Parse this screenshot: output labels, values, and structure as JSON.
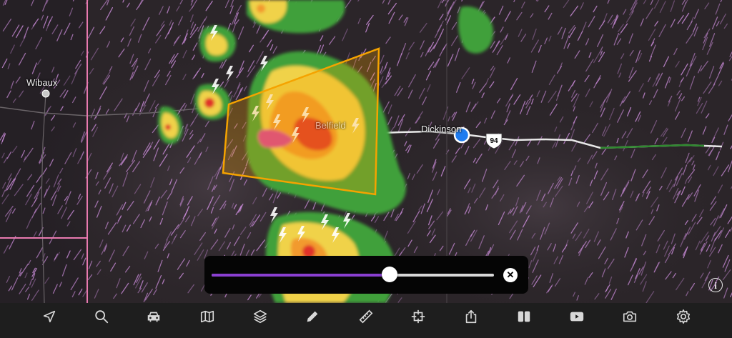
{
  "map": {
    "places": [
      {
        "name": "Wibaux"
      },
      {
        "name": "Dickinson"
      },
      {
        "name": "Belfield"
      }
    ],
    "highway_shield": "94",
    "warning_polygon_color": "#f5a300",
    "county_line_color": "#e87ab0",
    "location_dot_color": "#1e7cf0"
  },
  "timeline": {
    "progress": 0.63,
    "track_fill_color": "#8a3fd1",
    "close_symbol": "✕"
  },
  "info_symbol": "i",
  "toolbar": {
    "icons": [
      "location-arrow-icon",
      "search-icon",
      "car-icon",
      "map-icon",
      "layers-icon",
      "pencil-icon",
      "ruler-icon",
      "crosshair-icon",
      "share-icon",
      "split-view-icon",
      "play-video-icon",
      "camera-icon",
      "gear-icon"
    ]
  }
}
